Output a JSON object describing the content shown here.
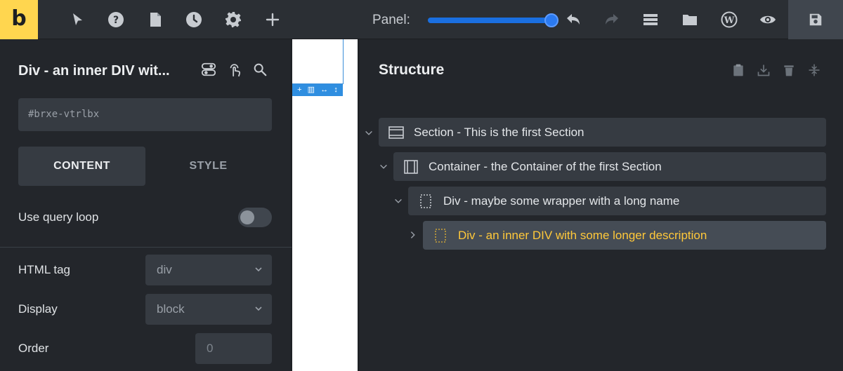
{
  "toolbar": {
    "logo_letter": "b",
    "panel_label": "Panel:",
    "panel_width_fraction": 0.95,
    "icons": [
      "pointer-icon",
      "help-icon",
      "page-icon",
      "history-icon",
      "settings-icon",
      "add-icon",
      "undo-icon",
      "redo-icon",
      "structure-icon",
      "folder-icon",
      "wordpress-icon",
      "preview-icon",
      "save-icon"
    ]
  },
  "element": {
    "title": "Div - an inner DIV wit...",
    "id": "#brxe-vtrlbx"
  },
  "tabs": {
    "content": "CONTENT",
    "style": "STYLE"
  },
  "settings": {
    "query_loop_label": "Use query loop",
    "query_loop_on": false,
    "html_tag_label": "HTML tag",
    "html_tag_value": "div",
    "display_label": "Display",
    "display_value": "block",
    "order_label": "Order",
    "order_placeholder": "0"
  },
  "canvas_toolbar": {
    "add": "+",
    "columns": "▥",
    "resize_h": "↔",
    "resize_v": "↕"
  },
  "structure": {
    "title": "Structure",
    "nodes": [
      {
        "label": "Section - This is the first Section",
        "type": "section",
        "expanded": true
      },
      {
        "label": "Container - the Container of the first Section",
        "type": "container",
        "expanded": true
      },
      {
        "label": "Div - maybe some wrapper with a long name",
        "type": "div",
        "expanded": true
      },
      {
        "label": "Div - an inner DIV with some longer description",
        "type": "div",
        "expanded": false,
        "active": true
      }
    ]
  },
  "colors": {
    "accent": "#ffd64f",
    "active_label": "#ffc83a",
    "slider": "#1a6fe0"
  }
}
